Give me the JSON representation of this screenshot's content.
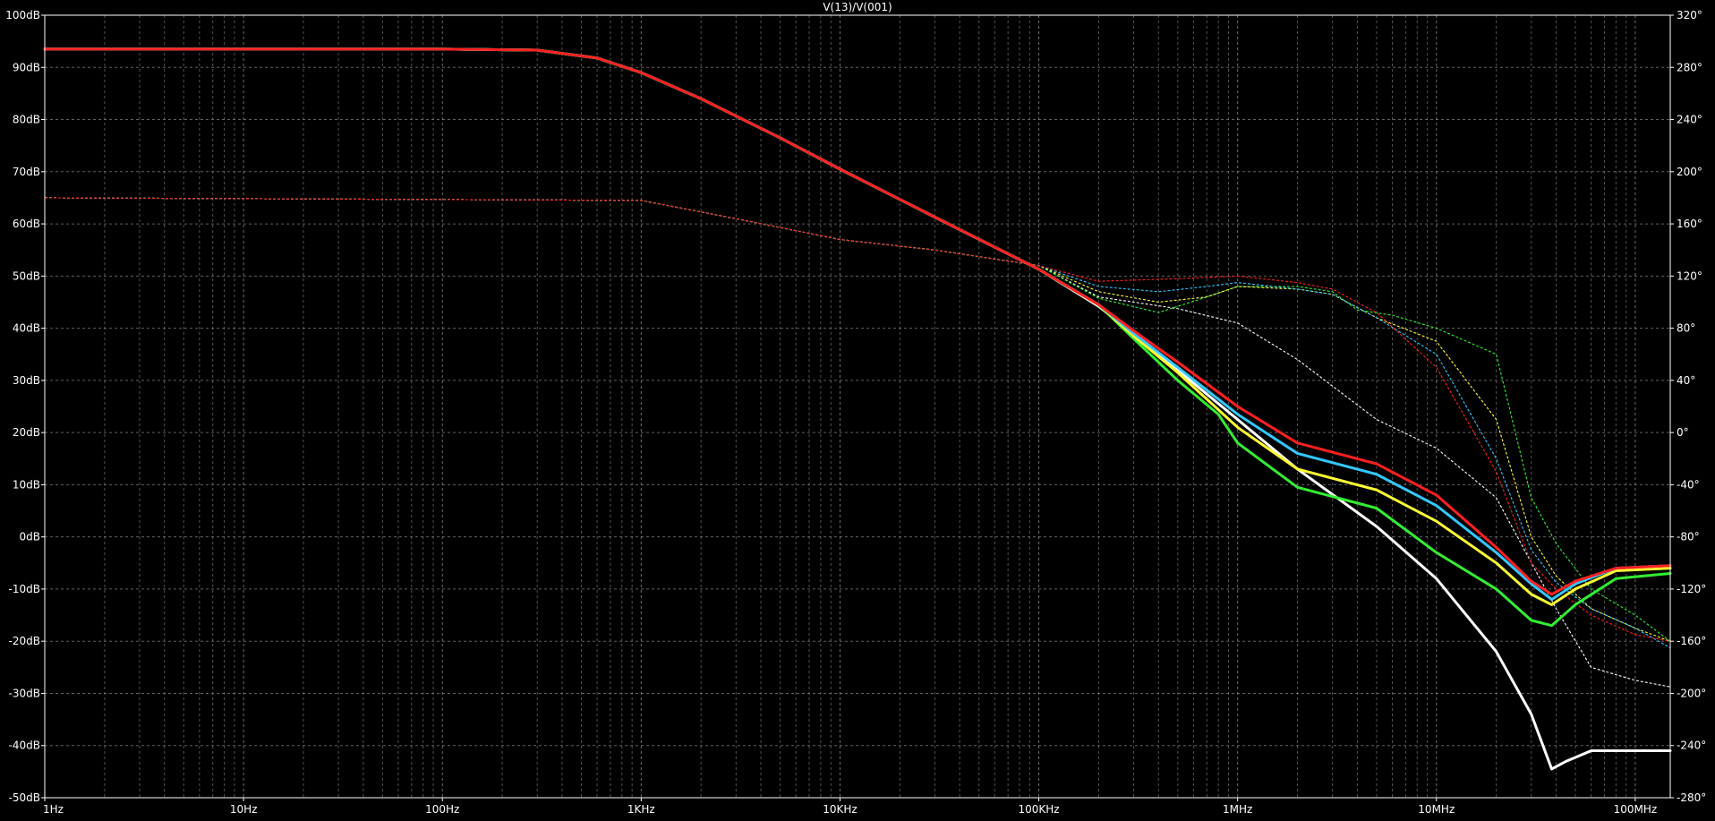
{
  "chart_data": {
    "type": "line",
    "title": "V(13)/V(001)",
    "x_scale": "log",
    "x_range_hz": [
      1,
      150000000
    ],
    "x_decade_labels": [
      {
        "value": 1,
        "label": "1Hz"
      },
      {
        "value": 10,
        "label": "10Hz"
      },
      {
        "value": 100,
        "label": "100Hz"
      },
      {
        "value": 1000,
        "label": "1KHz"
      },
      {
        "value": 10000,
        "label": "10KHz"
      },
      {
        "value": 100000,
        "label": "100KHz"
      },
      {
        "value": 1000000,
        "label": "1MHz"
      },
      {
        "value": 10000000,
        "label": "10MHz"
      },
      {
        "value": 100000000,
        "label": "100MHz"
      }
    ],
    "y_left": {
      "range": [
        -50,
        100
      ],
      "ticks": [
        {
          "value": 100,
          "label": "100dB"
        },
        {
          "value": 90,
          "label": "90dB"
        },
        {
          "value": 80,
          "label": "80dB"
        },
        {
          "value": 70,
          "label": "70dB"
        },
        {
          "value": 60,
          "label": "60dB"
        },
        {
          "value": 50,
          "label": "50dB"
        },
        {
          "value": 40,
          "label": "40dB"
        },
        {
          "value": 30,
          "label": "30dB"
        },
        {
          "value": 20,
          "label": "20dB"
        },
        {
          "value": 10,
          "label": "10dB"
        },
        {
          "value": 0,
          "label": "0dB"
        },
        {
          "value": -10,
          "label": "-10dB"
        },
        {
          "value": -20,
          "label": "-20dB"
        },
        {
          "value": -30,
          "label": "-30dB"
        },
        {
          "value": -40,
          "label": "-40dB"
        },
        {
          "value": -50,
          "label": "-50dB"
        }
      ]
    },
    "y_right": {
      "range": [
        -280,
        320
      ],
      "ticks": [
        {
          "value": 320,
          "label": "320°"
        },
        {
          "value": 280,
          "label": "280°"
        },
        {
          "value": 240,
          "label": "240°"
        },
        {
          "value": 200,
          "label": "200°"
        },
        {
          "value": 160,
          "label": "160°"
        },
        {
          "value": 120,
          "label": "120°"
        },
        {
          "value": 80,
          "label": "80°"
        },
        {
          "value": 40,
          "label": "40°"
        },
        {
          "value": 0,
          "label": "0°"
        },
        {
          "value": -40,
          "label": "-40°"
        },
        {
          "value": -80,
          "label": "-80°"
        },
        {
          "value": -120,
          "label": "-120°"
        },
        {
          "value": -160,
          "label": "-160°"
        },
        {
          "value": -200,
          "label": "-200°"
        },
        {
          "value": -240,
          "label": "-240°"
        },
        {
          "value": -280,
          "label": "-280°"
        }
      ]
    },
    "grid": true,
    "colors": {
      "background": "#000000",
      "axis": "#ffffff",
      "grid": "#8a8a8a",
      "text": "#ffffff"
    },
    "series": [
      {
        "kind": "magnitude_db",
        "color": "#ffffff",
        "points": [
          [
            1,
            93.5
          ],
          [
            100,
            93.5
          ],
          [
            300,
            93.3
          ],
          [
            600,
            91.8
          ],
          [
            1000,
            89
          ],
          [
            2000,
            84
          ],
          [
            5000,
            76.5
          ],
          [
            10000,
            70.5
          ],
          [
            30000,
            61.3
          ],
          [
            100000,
            51.3
          ],
          [
            200000,
            44.2
          ],
          [
            400000,
            35
          ],
          [
            1000000,
            22.5
          ],
          [
            2000000,
            13
          ],
          [
            5000000,
            2
          ],
          [
            10000000,
            -8
          ],
          [
            20000000,
            -22
          ],
          [
            30000000,
            -34
          ],
          [
            38000000,
            -44.5
          ],
          [
            45000000,
            -43
          ],
          [
            60000000,
            -41
          ],
          [
            150000000,
            -41
          ]
        ]
      },
      {
        "kind": "magnitude_db",
        "color": "#33ee33",
        "points": [
          [
            1,
            93.5
          ],
          [
            100,
            93.5
          ],
          [
            300,
            93.3
          ],
          [
            600,
            91.8
          ],
          [
            1000,
            89
          ],
          [
            2000,
            84
          ],
          [
            5000,
            76.5
          ],
          [
            10000,
            70.5
          ],
          [
            30000,
            61.3
          ],
          [
            100000,
            51.3
          ],
          [
            200000,
            44.5
          ],
          [
            300000,
            38
          ],
          [
            500000,
            30
          ],
          [
            800000,
            23.5
          ],
          [
            1000000,
            18
          ],
          [
            2000000,
            9.5
          ],
          [
            5000000,
            5.5
          ],
          [
            10000000,
            -3
          ],
          [
            20000000,
            -10
          ],
          [
            30000000,
            -16
          ],
          [
            38000000,
            -17
          ],
          [
            50000000,
            -13
          ],
          [
            80000000,
            -8
          ],
          [
            150000000,
            -7
          ]
        ]
      },
      {
        "kind": "magnitude_db",
        "color": "#ffff33",
        "points": [
          [
            1,
            93.5
          ],
          [
            100,
            93.5
          ],
          [
            300,
            93.3
          ],
          [
            600,
            91.8
          ],
          [
            1000,
            89
          ],
          [
            2000,
            84
          ],
          [
            5000,
            76.5
          ],
          [
            10000,
            70.5
          ],
          [
            30000,
            61.3
          ],
          [
            100000,
            51.3
          ],
          [
            200000,
            44.5
          ],
          [
            300000,
            38.5
          ],
          [
            500000,
            31.5
          ],
          [
            1000000,
            21
          ],
          [
            2000000,
            13
          ],
          [
            5000000,
            9
          ],
          [
            10000000,
            3
          ],
          [
            20000000,
            -5
          ],
          [
            30000000,
            -11
          ],
          [
            38000000,
            -13
          ],
          [
            50000000,
            -10
          ],
          [
            80000000,
            -6.5
          ],
          [
            150000000,
            -6
          ]
        ]
      },
      {
        "kind": "magnitude_db",
        "color": "#33c8ff",
        "points": [
          [
            1,
            93.5
          ],
          [
            100,
            93.5
          ],
          [
            300,
            93.3
          ],
          [
            600,
            91.8
          ],
          [
            1000,
            89
          ],
          [
            2000,
            84
          ],
          [
            5000,
            76.5
          ],
          [
            10000,
            70.5
          ],
          [
            30000,
            61.3
          ],
          [
            100000,
            51.3
          ],
          [
            200000,
            44.5
          ],
          [
            300000,
            39
          ],
          [
            500000,
            32.5
          ],
          [
            1000000,
            23.5
          ],
          [
            2000000,
            16
          ],
          [
            5000000,
            12
          ],
          [
            10000000,
            6
          ],
          [
            20000000,
            -3
          ],
          [
            30000000,
            -9
          ],
          [
            38000000,
            -12
          ],
          [
            50000000,
            -9
          ],
          [
            80000000,
            -6
          ],
          [
            150000000,
            -5.5
          ]
        ]
      },
      {
        "kind": "magnitude_db",
        "color": "#ff2020",
        "points": [
          [
            1,
            93.5
          ],
          [
            100,
            93.5
          ],
          [
            300,
            93.3
          ],
          [
            600,
            91.8
          ],
          [
            1000,
            89
          ],
          [
            2000,
            84
          ],
          [
            5000,
            76.5
          ],
          [
            10000,
            70.5
          ],
          [
            30000,
            61.3
          ],
          [
            100000,
            51.3
          ],
          [
            200000,
            44.5
          ],
          [
            300000,
            39.5
          ],
          [
            500000,
            33.5
          ],
          [
            1000000,
            25
          ],
          [
            2000000,
            18
          ],
          [
            5000000,
            14
          ],
          [
            10000000,
            8
          ],
          [
            20000000,
            -2
          ],
          [
            30000000,
            -8.5
          ],
          [
            38000000,
            -11
          ],
          [
            50000000,
            -8.5
          ],
          [
            80000000,
            -6
          ],
          [
            150000000,
            -5.5
          ]
        ]
      },
      {
        "kind": "phase_deg",
        "color": "#ffffff",
        "points": [
          [
            1,
            180
          ],
          [
            1000,
            178
          ],
          [
            3000,
            164
          ],
          [
            10000,
            148
          ],
          [
            30000,
            140
          ],
          [
            100000,
            128
          ],
          [
            200000,
            104
          ],
          [
            500000,
            95
          ],
          [
            1000000,
            84
          ],
          [
            2000000,
            56
          ],
          [
            5000000,
            10
          ],
          [
            10000000,
            -12
          ],
          [
            20000000,
            -50
          ],
          [
            40000000,
            -135
          ],
          [
            60000000,
            -180
          ],
          [
            100000000,
            -190
          ],
          [
            150000000,
            -195
          ]
        ]
      },
      {
        "kind": "phase_deg",
        "color": "#33ee33",
        "points": [
          [
            1,
            180
          ],
          [
            1000,
            178
          ],
          [
            3000,
            164
          ],
          [
            10000,
            148
          ],
          [
            30000,
            140
          ],
          [
            100000,
            128
          ],
          [
            200000,
            103
          ],
          [
            400000,
            92
          ],
          [
            700000,
            104
          ],
          [
            1000000,
            112
          ],
          [
            2000000,
            112
          ],
          [
            3000000,
            108
          ],
          [
            4000000,
            94
          ],
          [
            6000000,
            90
          ],
          [
            10000000,
            80
          ],
          [
            20000000,
            60
          ],
          [
            30000000,
            -50
          ],
          [
            40000000,
            -85
          ],
          [
            60000000,
            -120
          ],
          [
            100000000,
            -140
          ],
          [
            150000000,
            -160
          ]
        ]
      },
      {
        "kind": "phase_deg",
        "color": "#ffff33",
        "points": [
          [
            1,
            180
          ],
          [
            1000,
            178
          ],
          [
            3000,
            164
          ],
          [
            10000,
            148
          ],
          [
            30000,
            140
          ],
          [
            100000,
            128
          ],
          [
            200000,
            108
          ],
          [
            400000,
            100
          ],
          [
            700000,
            104
          ],
          [
            1000000,
            112
          ],
          [
            2000000,
            110
          ],
          [
            3000000,
            106
          ],
          [
            5000000,
            88
          ],
          [
            10000000,
            70
          ],
          [
            20000000,
            10
          ],
          [
            30000000,
            -80
          ],
          [
            40000000,
            -110
          ],
          [
            60000000,
            -135
          ],
          [
            100000000,
            -150
          ],
          [
            150000000,
            -160
          ]
        ]
      },
      {
        "kind": "phase_deg",
        "color": "#33c8ff",
        "points": [
          [
            1,
            180
          ],
          [
            1000,
            178
          ],
          [
            3000,
            164
          ],
          [
            10000,
            148
          ],
          [
            30000,
            140
          ],
          [
            100000,
            128
          ],
          [
            200000,
            112
          ],
          [
            400000,
            108
          ],
          [
            700000,
            112
          ],
          [
            1000000,
            115
          ],
          [
            2000000,
            110
          ],
          [
            3000000,
            106
          ],
          [
            5000000,
            88
          ],
          [
            10000000,
            60
          ],
          [
            20000000,
            -20
          ],
          [
            30000000,
            -90
          ],
          [
            40000000,
            -115
          ],
          [
            60000000,
            -135
          ],
          [
            100000000,
            -150
          ],
          [
            150000000,
            -165
          ]
        ]
      },
      {
        "kind": "phase_deg",
        "color": "#ff2020",
        "points": [
          [
            1,
            180
          ],
          [
            1000,
            178
          ],
          [
            3000,
            164
          ],
          [
            10000,
            148
          ],
          [
            30000,
            140
          ],
          [
            100000,
            128
          ],
          [
            200000,
            116
          ],
          [
            500000,
            118
          ],
          [
            1000000,
            120
          ],
          [
            2000000,
            115
          ],
          [
            3000000,
            110
          ],
          [
            5000000,
            92
          ],
          [
            10000000,
            50
          ],
          [
            20000000,
            -30
          ],
          [
            30000000,
            -100
          ],
          [
            40000000,
            -120
          ],
          [
            60000000,
            -140
          ],
          [
            100000000,
            -155
          ],
          [
            150000000,
            -160
          ]
        ]
      }
    ]
  }
}
